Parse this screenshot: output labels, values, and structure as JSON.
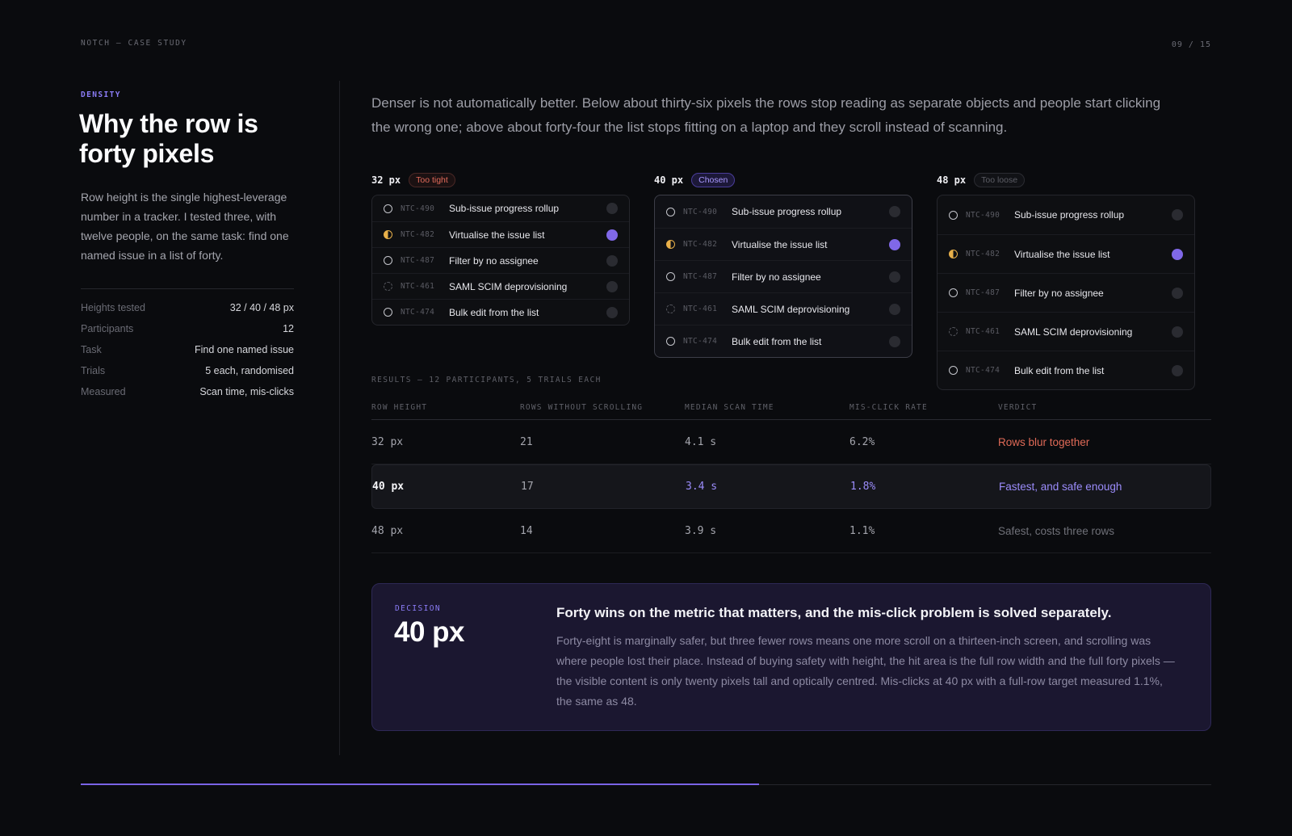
{
  "header": {
    "eyebrow": "NOTCH — CASE STUDY",
    "pager": "09 / 15",
    "progress_fraction": 0.6
  },
  "left": {
    "kicker": "DENSITY",
    "title": "Why the row is forty pixels",
    "lead": "Row height is the single highest-leverage number in a tracker. I tested three, with twelve people, on the same task: find one named issue in a list of forty.",
    "meta": [
      {
        "k": "Heights tested",
        "v": "32 / 40 / 48 px"
      },
      {
        "k": "Participants",
        "v": "12"
      },
      {
        "k": "Task",
        "v": "Find one named issue"
      },
      {
        "k": "Trials",
        "v": "5 each, randomised"
      },
      {
        "k": "Measured",
        "v": "Scan time, mis-clicks"
      }
    ]
  },
  "intro": "Denser is not automatically better. Below about thirty-six pixels the rows stop reading as separate objects and people start clicking the wrong one; above about forty-four the list stops fitting on a laptop and they scroll instead of scanning.",
  "variants": [
    {
      "size": "32 px",
      "tag": "Too tight"
    },
    {
      "size": "40 px",
      "tag": "Chosen"
    },
    {
      "size": "48 px",
      "tag": "Too loose"
    }
  ],
  "issues": [
    {
      "id": "NTC-490",
      "title": "Sub-issue progress rollup",
      "status": "todo-icon",
      "selected": false
    },
    {
      "id": "NTC-482",
      "title": "Virtualise the issue list",
      "status": "in-progress-icon",
      "selected": true
    },
    {
      "id": "NTC-487",
      "title": "Filter by no assignee",
      "status": "todo-icon",
      "selected": false
    },
    {
      "id": "NTC-461",
      "title": "SAML SCIM deprovisioning",
      "status": "backlog-icon",
      "selected": false
    },
    {
      "id": "NTC-474",
      "title": "Bulk edit from the list",
      "status": "todo-icon",
      "selected": false
    }
  ],
  "results": {
    "label": "RESULTS — 12 PARTICIPANTS, 5 TRIALS EACH",
    "headers": [
      "ROW HEIGHT",
      "ROWS WITHOUT SCROLLING",
      "MEDIAN SCAN TIME",
      "MIS-CLICK RATE",
      "VERDICT"
    ],
    "rows": [
      [
        "32 px",
        "21",
        "4.1 s",
        "6.2%",
        "Rows blur together"
      ],
      [
        "40 px",
        "17",
        "3.4 s",
        "1.8%",
        "Fastest, and safe enough"
      ],
      [
        "48 px",
        "14",
        "3.9 s",
        "1.1%",
        "Safest, costs three rows"
      ]
    ]
  },
  "decision": {
    "kicker": "DECISION",
    "value": "40 px",
    "headline": "Forty wins on the metric that matters, and the mis-click problem is solved separately.",
    "body": "Forty-eight is marginally safer, but three fewer rows means one more scroll on a thirteen-inch screen, and scrolling was where people lost their place. Instead of buying safety with height, the hit area is the full row width and the full forty pixels — the visible content is only twenty pixels tall and optically centred. Mis-clicks at 40 px with a full-row target measured 1.1%, the same as 48."
  },
  "colors": {
    "accent": "#8b7cf6",
    "danger": "#e06a57",
    "in_progress": "#e8b04a",
    "background": "#0a0b0e"
  }
}
